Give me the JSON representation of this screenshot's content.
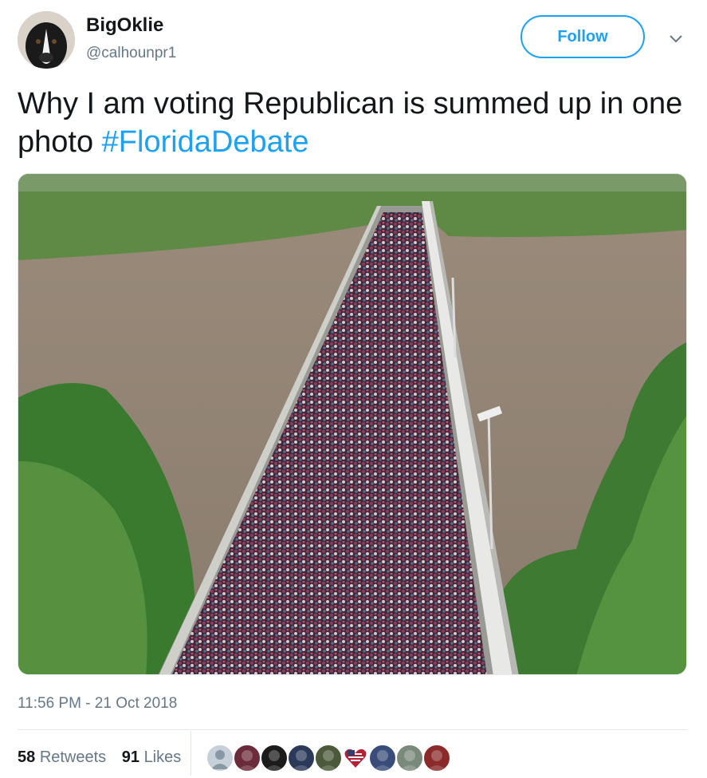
{
  "author": {
    "name": "BigOklie",
    "handle": "@calhounpr1"
  },
  "follow_label": "Follow",
  "tweet": {
    "text_before": "Why I am voting Republican is summed up in one photo ",
    "hashtag": "#FloridaDebate"
  },
  "timestamp": "11:56 PM - 21 Oct 2018",
  "stats": {
    "retweets_count": "58",
    "retweets_label": "Retweets",
    "likes_count": "91",
    "likes_label": "Likes"
  },
  "likers": [
    {
      "icon": "default-avatar-icon",
      "color": "#c7d0d8"
    },
    {
      "icon": "avatar",
      "color": "#6b2b3a"
    },
    {
      "icon": "avatar",
      "color": "#1b1b1b"
    },
    {
      "icon": "avatar",
      "color": "#2c3a5a"
    },
    {
      "icon": "avatar",
      "color": "#4a5a3a"
    },
    {
      "icon": "us-flag-heart-icon",
      "color": "#b22234"
    },
    {
      "icon": "avatar",
      "color": "#3a4d7a"
    },
    {
      "icon": "avatar",
      "color": "#7a8a7a"
    },
    {
      "icon": "avatar",
      "color": "#8a2a2a"
    }
  ],
  "colors": {
    "accent": "#1da1f2",
    "text": "#14171a",
    "secondary": "#657786"
  }
}
